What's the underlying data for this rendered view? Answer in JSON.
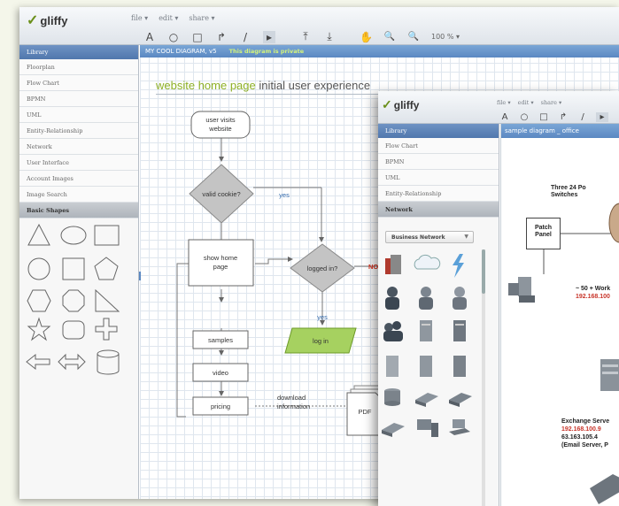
{
  "app1": {
    "logo": "gliffy",
    "menu": [
      "file ▾",
      "edit ▾",
      "share ▾"
    ],
    "tools": [
      "A",
      "○",
      "□",
      "↱",
      "/",
      "▸",
      "⤒",
      "⤓",
      "✋",
      "🔍",
      "🔍"
    ],
    "zoom": "100 % ▾",
    "sidebar_head": "Library",
    "sidebar_items": [
      "Floorplan",
      "Flow Chart",
      "BPMN",
      "UML",
      "Entity-Relationship",
      "Network",
      "User Interface",
      "Account Images",
      "Image Search"
    ],
    "sidebar_selected": "Basic Shapes",
    "diagram_name": "MY COOL DIAGRAM, v5",
    "private_note": "This diagram is private",
    "title_accent": "website home page",
    "title_rest": " initial user experience"
  },
  "flowchart": {
    "start": [
      "user visits",
      "website"
    ],
    "cookie": "valid cookie?",
    "yes": "yes",
    "no": "no",
    "home": [
      "show home",
      "page"
    ],
    "logged": "logged in?",
    "no_red": "NO",
    "yes2": "yes",
    "login": "log in",
    "samples": "samples",
    "video": "video",
    "pricing": "pricing",
    "download": [
      "download",
      "information"
    ],
    "pdf": "PDF"
  },
  "app2": {
    "logo": "gliffy",
    "menu": [
      "file ▾",
      "edit ▾",
      "share ▾"
    ],
    "tools": [
      "A",
      "○",
      "□",
      "↱",
      "/",
      "▸"
    ],
    "sidebar_head": "Library",
    "sidebar_items": [
      "Flow Chart",
      "BPMN",
      "UML",
      "Entity-Relationship"
    ],
    "sidebar_selected": "Network",
    "dropdown": "Business Network",
    "diagram_name": "sample diagram _ office",
    "switches": [
      "Three 24 Po",
      "Switches"
    ],
    "patch": [
      "Patch",
      "Panel"
    ],
    "workstations": "~ 50 + Work",
    "ws_ip": "192.168.100",
    "exchange": "Exchange Serve",
    "ex_ip1": "192.168.100.9",
    "ex_ip2": "63.163.105.4",
    "ex_note": "(Email Server, P"
  },
  "colors": {
    "accent_green": "#8eb026",
    "header_blue": "#5b88c2",
    "diamond_gray": "#c4c4c4",
    "login_green": "#a6d160",
    "no_red": "#e0331f"
  }
}
